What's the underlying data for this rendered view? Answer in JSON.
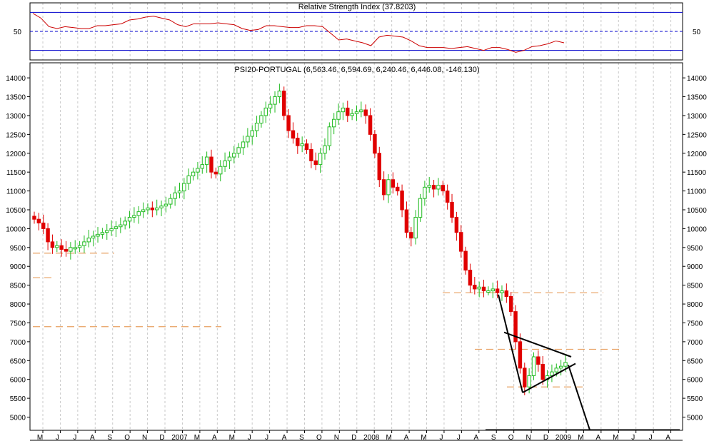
{
  "colors": {
    "up": "#22bb22",
    "down": "#e00000",
    "rsi_line": "#cc0000",
    "rsi_bands": "#0000cc",
    "support": "#e8a060",
    "grid": "#c8c8c8",
    "trend": "#000000"
  },
  "chart_data": [
    {
      "type": "line",
      "title": "Relative Strength Index (37.8203)",
      "y_tick_labels": [
        "50"
      ],
      "ylim": [
        20,
        80
      ],
      "bands": [
        70,
        50,
        30
      ],
      "x": [
        0,
        2,
        4,
        6,
        8,
        10,
        12,
        14,
        16,
        18,
        20,
        22,
        24,
        26,
        28,
        30,
        32,
        34,
        36,
        38,
        40,
        42,
        44,
        46,
        48,
        50,
        52,
        54,
        56,
        58,
        60,
        62,
        64,
        66,
        68,
        70,
        72,
        74,
        76,
        78,
        80,
        82,
        84,
        86,
        88,
        90,
        92,
        94,
        96,
        98,
        100,
        102
      ],
      "values": [
        69,
        64,
        55,
        53,
        55,
        54,
        53,
        53,
        56,
        56,
        57,
        58,
        62,
        63,
        65,
        66,
        64,
        62,
        57,
        55,
        58,
        58,
        58,
        59,
        58,
        57,
        53,
        51,
        52,
        56,
        56,
        55,
        54,
        54,
        56,
        56,
        55,
        48,
        41,
        42,
        40,
        38,
        35,
        44,
        46,
        45,
        44,
        40,
        35,
        33,
        33,
        33,
        32,
        33,
        34,
        32,
        30,
        33,
        33,
        31,
        28,
        30,
        34,
        35,
        37,
        40,
        38
      ]
    },
    {
      "type": "candlestick",
      "title": "PSI20-PORTUGAL (6,563.46, 6,594.69, 6,240.46, 6,446.08, -146.130)",
      "x_tick_labels": [
        "M",
        "J",
        "J",
        "A",
        "S",
        "O",
        "N",
        "D",
        "2007",
        "M",
        "A",
        "M",
        "J",
        "J",
        "A",
        "S",
        "O",
        "N",
        "D",
        "2008",
        "M",
        "A",
        "M",
        "J",
        "J",
        "A",
        "S",
        "O",
        "N",
        "D",
        "2009",
        "M",
        "A",
        "M",
        "J",
        "J",
        "A"
      ],
      "y_tick_labels": [
        "5000",
        "5500",
        "6000",
        "6500",
        "7000",
        "7500",
        "8000",
        "8500",
        "9000",
        "9500",
        "10000",
        "10500",
        "11000",
        "11500",
        "12000",
        "12500",
        "13000",
        "13500",
        "14000"
      ],
      "ylim": [
        4650,
        14400
      ],
      "closes": [
        10250,
        10150,
        10000,
        9650,
        9500,
        9550,
        9450,
        9400,
        9500,
        9500,
        9550,
        9650,
        9750,
        9800,
        9850,
        9900,
        9950,
        10000,
        10050,
        10100,
        10200,
        10300,
        10350,
        10450,
        10500,
        10550,
        10500,
        10550,
        10600,
        10650,
        10800,
        10950,
        11000,
        11200,
        11400,
        11500,
        11600,
        11700,
        11900,
        11500,
        11450,
        11650,
        11800,
        11900,
        12000,
        12150,
        12300,
        12450,
        12600,
        12800,
        13000,
        13200,
        13300,
        13500,
        13650,
        13000,
        12600,
        12400,
        12200,
        12250,
        12100,
        11800,
        11700,
        12000,
        12200,
        12700,
        12900,
        13100,
        13200,
        13000,
        13050,
        13100,
        13150,
        13000,
        12500,
        12000,
        11300,
        10900,
        11300,
        11100,
        11000,
        10500,
        9900,
        9750,
        10300,
        10800,
        11100,
        11150,
        11050,
        11150,
        11000,
        10700,
        10300,
        9900,
        9400,
        8900,
        8500,
        8400,
        8450,
        8350,
        8350,
        8400,
        8300,
        8350,
        8200,
        7800,
        7000,
        6300,
        5800,
        6100,
        6600,
        6400,
        6000,
        6100,
        6200,
        6300,
        6350,
        6450
      ],
      "support_levels": [
        9350,
        8700,
        7400,
        8300,
        6800,
        5800
      ],
      "trendlines": "triangle pattern with projected breakdown to ~4650"
    }
  ]
}
